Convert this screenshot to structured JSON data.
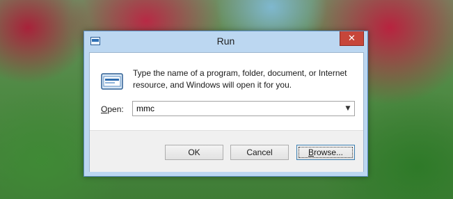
{
  "window": {
    "title": "Run",
    "close_glyph": "✕"
  },
  "message": {
    "line1": "Type the name of a program, folder, document, or Internet",
    "line2": "resource, and Windows will open it for you."
  },
  "open_field": {
    "label_accel": "O",
    "label_rest": "pen:",
    "value": "mmc",
    "arrow": "▼"
  },
  "buttons": {
    "ok": "OK",
    "cancel": "Cancel",
    "browse_accel": "B",
    "browse_rest": "rowse..."
  },
  "icons": {
    "title_icon": "run-app-icon",
    "dialog_icon": "run-dialog-icon"
  },
  "colors": {
    "frame": "#bcd7f1",
    "close": "#c7463a"
  }
}
